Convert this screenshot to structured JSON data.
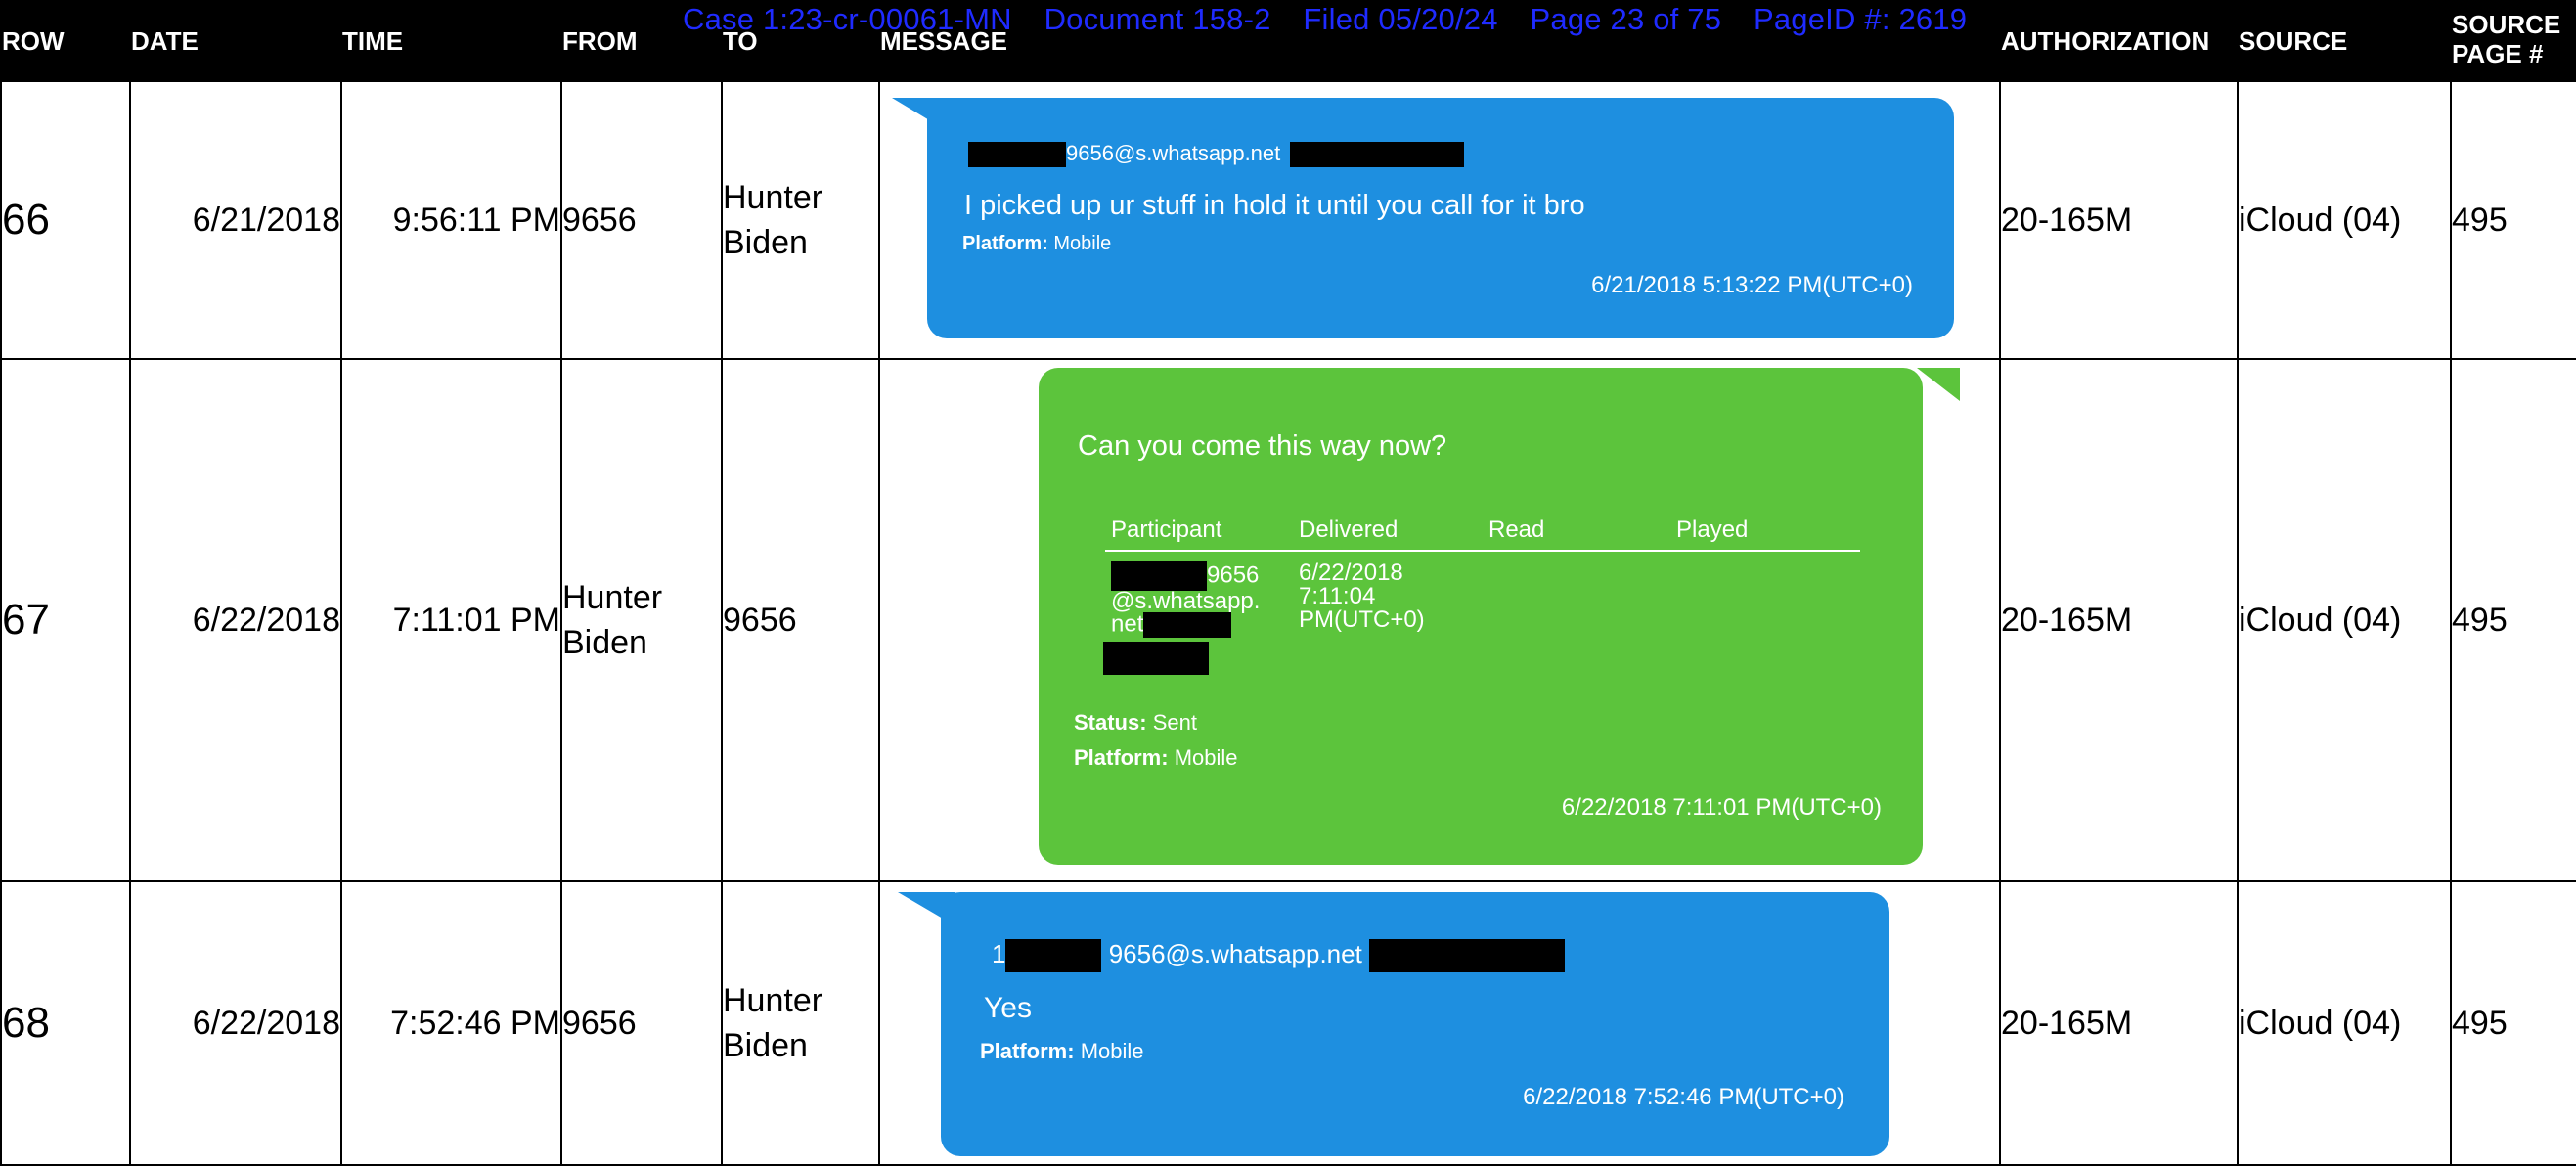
{
  "stamp": {
    "case": "Case 1:23-cr-00061-MN",
    "document": "Document 158-2",
    "filed": "Filed 05/20/24",
    "page": "Page 23 of 75",
    "page_id": "PageID #: 2619"
  },
  "columns": {
    "row": "ROW",
    "date": "DATE",
    "time": "TIME",
    "from": "FROM",
    "to": "TO",
    "message": "MESSAGE",
    "authorization": "AUTHORIZATION",
    "source": "SOURCE",
    "source_page_1": "SOURCE",
    "source_page_2": "PAGE #"
  },
  "rows": [
    {
      "row": "66",
      "date": "6/21/2018",
      "time": "9:56:11 PM",
      "from_1": "9656",
      "from_2": "",
      "to_1": "Hunter",
      "to_2": "Biden",
      "authorization": "20-165M",
      "source": "iCloud (04)",
      "source_page": "495",
      "message": {
        "color": "#1e8fe0",
        "sender": "9656@s.whatsapp.net",
        "text": "I picked up ur stuff in hold it until you call for it bro",
        "platform_label": "Platform:",
        "platform_value": "Mobile",
        "timestamp": "6/21/2018 5:13:22 PM(UTC+0)"
      }
    },
    {
      "row": "67",
      "date": "6/22/2018",
      "time": "7:11:01 PM",
      "from_1": "Hunter",
      "from_2": "Biden",
      "to_1": "9656",
      "to_2": "",
      "authorization": "20-165M",
      "source": "iCloud (04)",
      "source_page": "495",
      "message": {
        "color": "#5cc43c",
        "text": "Can you come this way now?",
        "participants_headers": [
          "Participant",
          "Delivered",
          "Read",
          "Played"
        ],
        "participant_line_1": "9656",
        "participant_line_2": "@s.whatsapp.",
        "participant_line_3": "net",
        "delivered_line_1": "6/22/2018",
        "delivered_line_2": "7:11:04",
        "delivered_line_3": "PM(UTC+0)",
        "status_label": "Status:",
        "status_value": "Sent",
        "platform_label": "Platform:",
        "platform_value": "Mobile",
        "timestamp": "6/22/2018 7:11:01 PM(UTC+0)"
      }
    },
    {
      "row": "68",
      "date": "6/22/2018",
      "time": "7:52:46 PM",
      "from_1": "9656",
      "from_2": "",
      "to_1": "Hunter",
      "to_2": "Biden",
      "authorization": "20-165M",
      "source": "iCloud (04)",
      "source_page": "495",
      "message": {
        "color": "#1e8fe0",
        "sender_prefix": "1",
        "sender": "9656@s.whatsapp.net",
        "text": "Yes",
        "platform_label": "Platform:",
        "platform_value": "Mobile",
        "timestamp": "6/22/2018 7:52:46 PM(UTC+0)"
      }
    }
  ]
}
